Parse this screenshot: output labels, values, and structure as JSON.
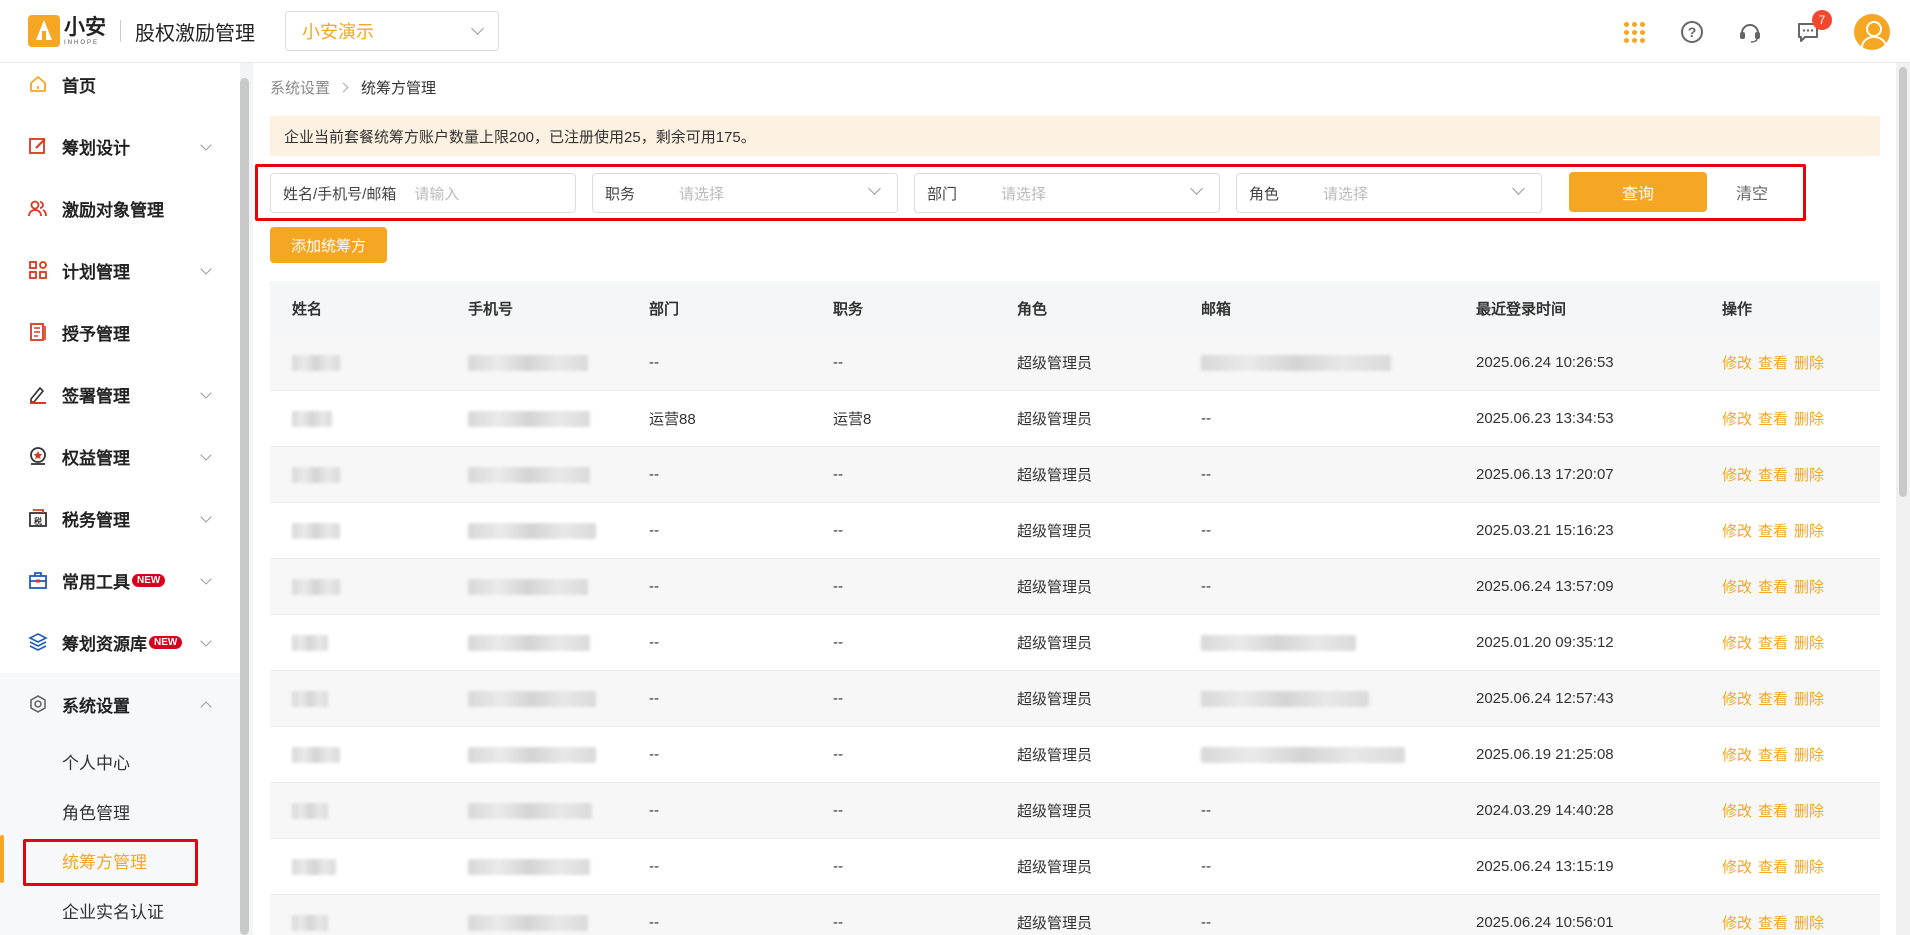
{
  "header": {
    "logo_cn": "小安",
    "logo_en": "INHOPE",
    "app_title": "股权激励管理",
    "company": "小安演示",
    "message_badge": "7"
  },
  "sidebar": {
    "items": [
      {
        "label": "首页",
        "icon": "home-icon"
      },
      {
        "label": "筹划设计",
        "icon": "edit-icon"
      },
      {
        "label": "激励对象管理",
        "icon": "users-icon"
      },
      {
        "label": "计划管理",
        "icon": "apps-icon"
      },
      {
        "label": "授予管理",
        "icon": "book-icon"
      },
      {
        "label": "签署管理",
        "icon": "sign-icon"
      },
      {
        "label": "权益管理",
        "icon": "medal-icon"
      },
      {
        "label": "税务管理",
        "icon": "tax-icon"
      },
      {
        "label": "常用工具",
        "icon": "toolbox-icon",
        "badge": "NEW"
      },
      {
        "label": "筹划资源库",
        "icon": "layers-icon",
        "badge": "NEW"
      },
      {
        "label": "系统设置",
        "icon": "settings-icon"
      }
    ],
    "sub_items": [
      "个人中心",
      "角色管理",
      "统筹方管理",
      "企业实名认证"
    ]
  },
  "breadcrumb": {
    "parent": "系统设置",
    "current": "统筹方管理"
  },
  "notice": "企业当前套餐统筹方账户数量上限200，已注册使用25，剩余可用175。",
  "filters": {
    "name_label": "姓名/手机号/邮箱",
    "name_placeholder": "请输入",
    "position_label": "职务",
    "department_label": "部门",
    "role_label": "角色",
    "select_placeholder": "请选择",
    "query": "查询",
    "clear": "清空"
  },
  "add_button": "添加统筹方",
  "table": {
    "headers": [
      "姓名",
      "手机号",
      "部门",
      "职务",
      "角色",
      "邮箱",
      "最近登录时间",
      "操作"
    ],
    "actions": {
      "edit": "修改",
      "view": "查看",
      "delete": "删除"
    },
    "rows": [
      {
        "dept": "--",
        "position": "--",
        "role": "超级管理员",
        "email": "",
        "time": "2025.06.24 10:26:53"
      },
      {
        "dept": "运营88",
        "position": "运营8",
        "role": "超级管理员",
        "email": "--",
        "time": "2025.06.23 13:34:53"
      },
      {
        "dept": "--",
        "position": "--",
        "role": "超级管理员",
        "email": "--",
        "time": "2025.06.13 17:20:07"
      },
      {
        "dept": "--",
        "position": "--",
        "role": "超级管理员",
        "email": "--",
        "time": "2025.03.21 15:16:23"
      },
      {
        "dept": "--",
        "position": "--",
        "role": "超级管理员",
        "email": "--",
        "time": "2025.06.24 13:57:09"
      },
      {
        "dept": "--",
        "position": "--",
        "role": "超级管理员",
        "email": "",
        "time": "2025.01.20 09:35:12"
      },
      {
        "dept": "--",
        "position": "--",
        "role": "超级管理员",
        "email": "",
        "time": "2025.06.24 12:57:43"
      },
      {
        "dept": "--",
        "position": "--",
        "role": "超级管理员",
        "email": "",
        "time": "2025.06.19 21:25:08"
      },
      {
        "dept": "--",
        "position": "--",
        "role": "超级管理员",
        "email": "--",
        "time": "2024.03.29 14:40:28"
      },
      {
        "dept": "--",
        "position": "--",
        "role": "超级管理员",
        "email": "--",
        "time": "2025.06.24 13:15:19"
      },
      {
        "dept": "--",
        "position": "--",
        "role": "超级管理员",
        "email": "--",
        "time": "2025.06.24 10:56:01"
      }
    ]
  },
  "colors": {
    "accent": "#f5a623",
    "highlight_box": "#e60012",
    "notice_bg": "#fdf1e1"
  }
}
